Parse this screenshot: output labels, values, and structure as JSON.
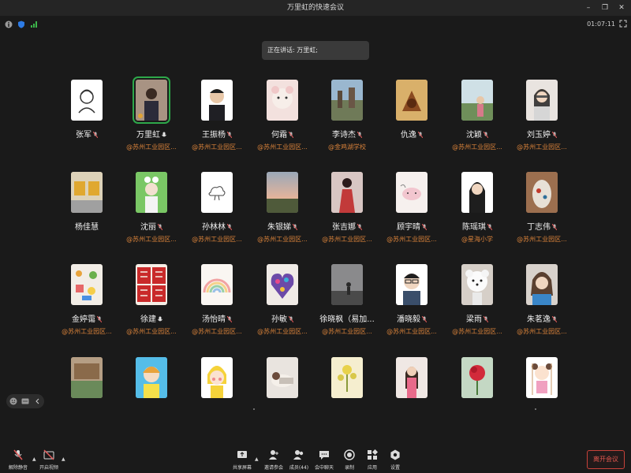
{
  "window": {
    "title": "万里虹的快速会议"
  },
  "topbar": {
    "timer": "01:07:11"
  },
  "speaking": {
    "label": "正在讲话: 万里虹;"
  },
  "participants": [
    {
      "name": "张军",
      "org": ""
    },
    {
      "name": "万里虹",
      "org": "@苏州工业园区..."
    },
    {
      "name": "王振杨",
      "org": "@苏州工业园区..."
    },
    {
      "name": "何霜",
      "org": "@苏州工业园区..."
    },
    {
      "name": "李诗杰",
      "org": "@金鸡湖学校"
    },
    {
      "name": "仇逸",
      "org": ""
    },
    {
      "name": "沈颖",
      "org": "@苏州工业园区..."
    },
    {
      "name": "刘玉婷",
      "org": "@苏州工业园区..."
    },
    {
      "name": "杨佳慧",
      "org": ""
    },
    {
      "name": "沈丽",
      "org": "@苏州工业园区..."
    },
    {
      "name": "孙林林",
      "org": "@苏州工业园区..."
    },
    {
      "name": "朱银娣",
      "org": "@苏州工业园区..."
    },
    {
      "name": "张吉娜",
      "org": "@苏州工业园区..."
    },
    {
      "name": "顾宇晴",
      "org": "@苏州工业园区..."
    },
    {
      "name": "陈瑶琪",
      "org": "@星海小学"
    },
    {
      "name": "丁志伟",
      "org": "@苏州工业园区..."
    },
    {
      "name": "金婷霭",
      "org": "@苏州工业园区..."
    },
    {
      "name": "徐建",
      "org": "@苏州工业园区..."
    },
    {
      "name": "汤怡晴",
      "org": "@苏州工业园区..."
    },
    {
      "name": "孙敏",
      "org": "@苏州工业园区..."
    },
    {
      "name": "徐晓枫（易加...",
      "org": "@苏州工业园区..."
    },
    {
      "name": "潘晓毅",
      "org": "@苏州工业园区..."
    },
    {
      "name": "梁雨",
      "org": "@苏州工业园区..."
    },
    {
      "name": "朱茗逸",
      "org": "@苏州工业园区..."
    }
  ],
  "toolbar": {
    "unmute": "解除静音",
    "start_video": "开启视频",
    "share_screen": "共享屏幕",
    "invite": "邀请参会",
    "members": "成员(44)",
    "chat": "会中聊天",
    "record": "录制",
    "apps": "应用",
    "settings": "设置",
    "leave": "离开会议"
  },
  "colors": {
    "background": "#1a1a1a",
    "accent_org": "#d9823a",
    "leave": "#e2574e",
    "active": "#2ea84a"
  }
}
